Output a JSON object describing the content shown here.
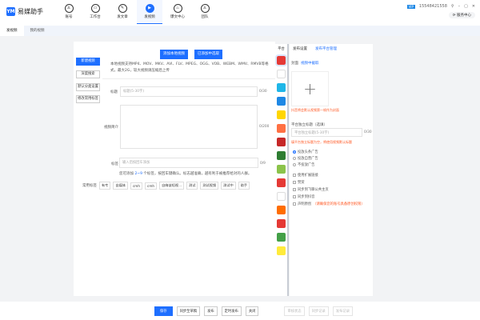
{
  "app": {
    "name": "易媒助手",
    "logo_text": "YM"
  },
  "nav": [
    {
      "label": "账号",
      "icon": "user-icon"
    },
    {
      "label": "工作台",
      "icon": "monitor-icon"
    },
    {
      "label": "发文章",
      "icon": "pen-icon"
    },
    {
      "label": "发视频",
      "icon": "play-icon",
      "active": true
    },
    {
      "label": "爆文中心",
      "icon": "fire-icon"
    },
    {
      "label": "团队",
      "icon": "team-icon"
    }
  ],
  "window": {
    "vip": "VIP",
    "account": "15548421558",
    "service": "服务中心"
  },
  "subtabs": [
    {
      "label": "发视频",
      "active": true
    },
    {
      "label": "我的视频"
    }
  ],
  "sidebar": [
    "新建视频",
    "深度搜索",
    "默认分类设置",
    "修改常用标签"
  ],
  "upload": {
    "local": "添加本地视频",
    "added": "已添加中选取",
    "hint": "本地视频支持MP4、MOV、MKV、AVI、FLV、MPEG、OGG、VOB、WEBM、WMV、RMVB等格式，最大2G，较大视频请压缩后上传"
  },
  "form": {
    "title_label": "标题",
    "title_placeholder": "标题(5-30字)",
    "title_count": "0/30",
    "intro_label": "视频简介",
    "intro_count": "0/200",
    "tag_label": "标签",
    "tag_placeholder": "输入后按回车添加",
    "tag_count": "0/9",
    "tag_hint_pre": "您可添加",
    "tag_hint_num": "2~9",
    "tag_hint_post": "个标签，按回车键确认。标志越准确，越有利于被推荐给对的人群。",
    "common_label": "常用标签",
    "common_tags": [
      "有专",
      "自媒体",
      "cmh",
      "cmh",
      "自嗨该短视...",
      "测试",
      "测试视频",
      "测试中",
      "助手"
    ]
  },
  "platforms": [
    "#e53935",
    "#ffffff",
    "#1fb6e8",
    "#1e88e5",
    "#ffd600",
    "#ff7043",
    "#c62828",
    "#2e7d32",
    "#8bc34a",
    "#e53935",
    "#ffffff",
    "#ff6d00",
    "#e53935",
    "#43a047",
    "#ffeb3b"
  ],
  "right": {
    "tabs": [
      "发布设置",
      "发布平台管理"
    ],
    "cover_label": "封面",
    "cover_link": "视频中截取",
    "cover_hint": "抖音将会默认视频第一帧作为封面",
    "platform_title_label": "平台独立标题（选填）",
    "platform_title_placeholder": "平台独立标题(5-30字)",
    "platform_title_count": "0/30",
    "platform_title_hint": "填平台独立标题为空，将使用视频默认标题",
    "radios": [
      {
        "label": "投放头条广告",
        "checked": true
      },
      {
        "label": "投放自营广告"
      },
      {
        "label": "不投放广告"
      }
    ],
    "checks": [
      "使用扩展链接",
      "赞赏",
      "同步到飞聊公共主页",
      "同步到抖音",
      "声明原创"
    ],
    "original_note": "（请确保您的账号具备原创权限）"
  },
  "bottom": {
    "buttons": [
      "保存",
      "同步至草稿",
      "发布",
      "定时发布",
      "关闭"
    ],
    "disabled": [
      "审核状态",
      "同步记录",
      "发布记录"
    ]
  },
  "colors": {
    "accent": "#1e6fff",
    "warning": "#ff5722"
  }
}
